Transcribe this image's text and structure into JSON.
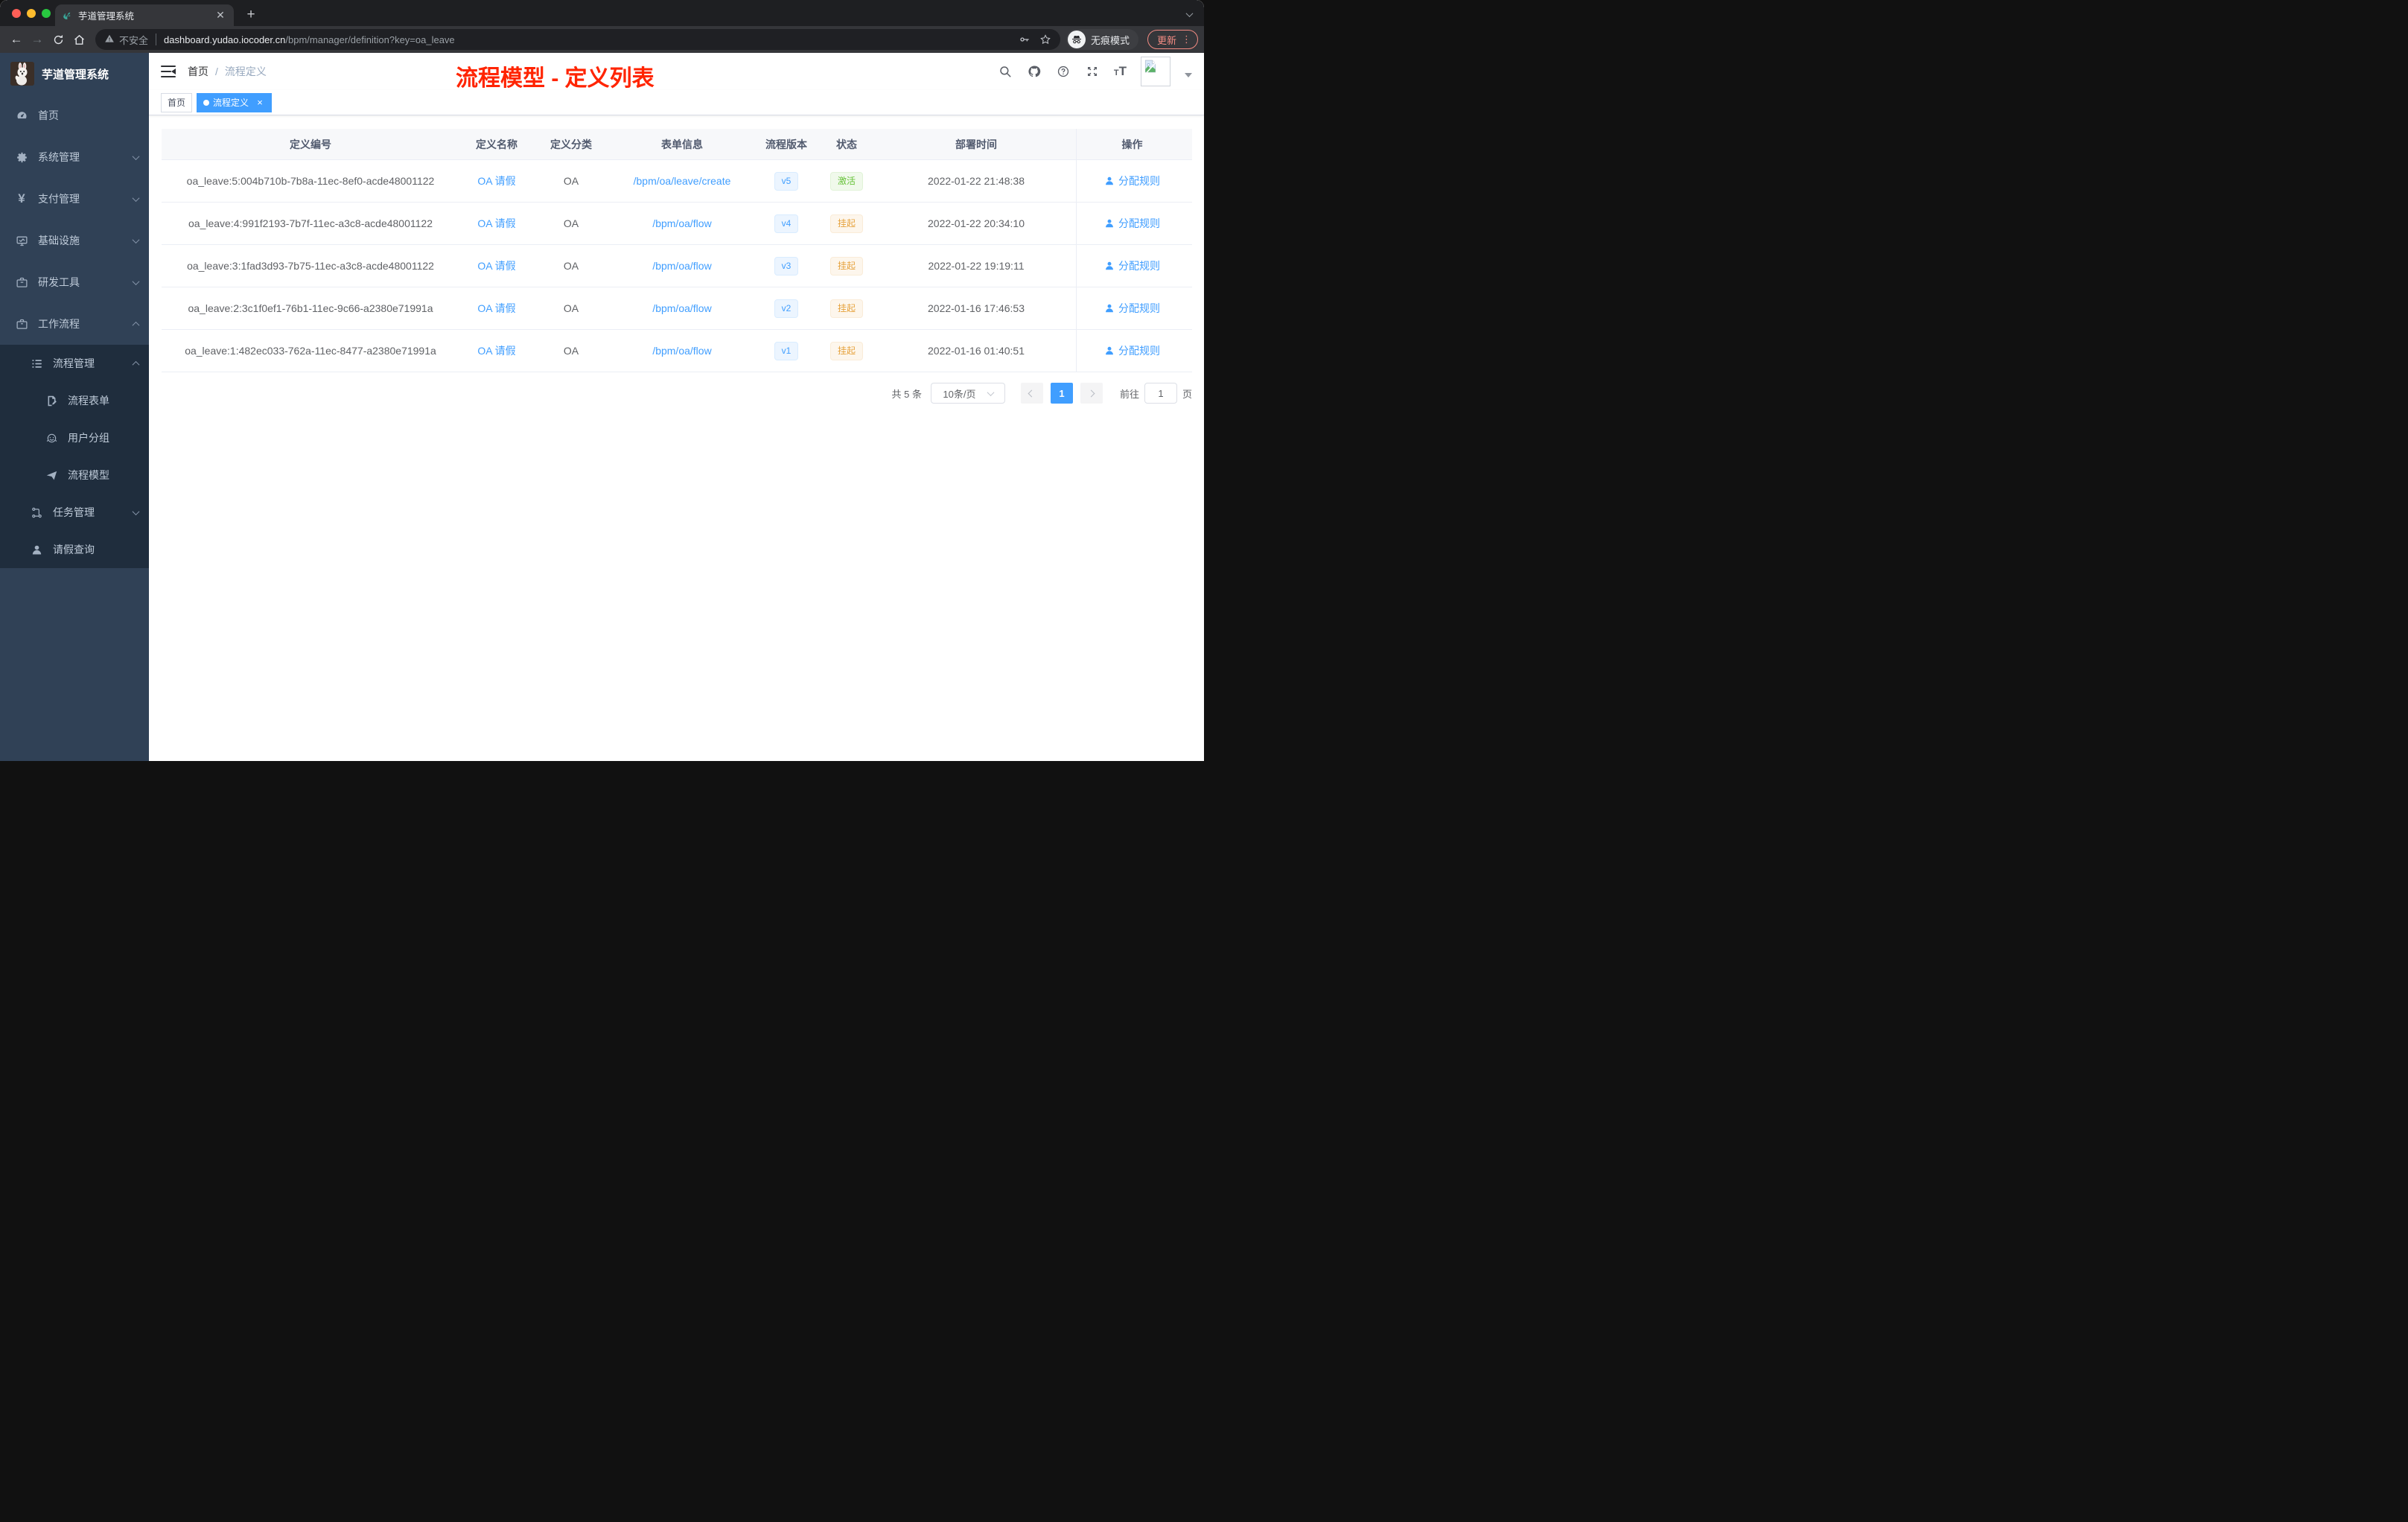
{
  "browser": {
    "tab_title": "芋道管理系统",
    "security_label": "不安全",
    "url_host": "dashboard.yudao.iocoder.cn",
    "url_path": "/bpm/manager/definition?key=oa_leave",
    "incognito_label": "无痕模式",
    "update_label": "更新"
  },
  "sidebar": {
    "logo_title": "芋道管理系统",
    "items": [
      {
        "key": "home",
        "label": "首页",
        "icon": "dashboard-icon",
        "level": 1,
        "chevron": "",
        "dark": false
      },
      {
        "key": "system",
        "label": "系统管理",
        "icon": "gear-icon",
        "level": 1,
        "chevron": "down",
        "dark": false
      },
      {
        "key": "pay",
        "label": "支付管理",
        "icon": "yen-icon",
        "level": 1,
        "chevron": "down",
        "dark": false
      },
      {
        "key": "infra",
        "label": "基础设施",
        "icon": "monitor-icon",
        "level": 1,
        "chevron": "down",
        "dark": false
      },
      {
        "key": "devtools",
        "label": "研发工具",
        "icon": "toolbox-icon",
        "level": 1,
        "chevron": "down",
        "dark": false
      },
      {
        "key": "workflow",
        "label": "工作流程",
        "icon": "briefcase-icon",
        "level": 1,
        "chevron": "up",
        "dark": false
      },
      {
        "key": "process-mgmt",
        "label": "流程管理",
        "icon": "list-icon",
        "level": 2,
        "chevron": "up",
        "dark": true
      },
      {
        "key": "process-form",
        "label": "流程表单",
        "icon": "form-icon",
        "level": 3,
        "chevron": "",
        "dark": true
      },
      {
        "key": "user-group",
        "label": "用户分组",
        "icon": "robot-icon",
        "level": 3,
        "chevron": "",
        "dark": true
      },
      {
        "key": "process-model",
        "label": "流程模型",
        "icon": "plane-icon",
        "level": 3,
        "chevron": "",
        "dark": true
      },
      {
        "key": "task-mgmt",
        "label": "任务管理",
        "icon": "tree-icon",
        "level": 2,
        "chevron": "down",
        "dark": true
      },
      {
        "key": "leave-query",
        "label": "请假查询",
        "icon": "user-icon",
        "level": 2,
        "chevron": "",
        "dark": true
      }
    ]
  },
  "header": {
    "breadcrumb": [
      "首页",
      "流程定义"
    ],
    "breadcrumb_separator": "/",
    "annotation": "流程模型 - 定义列表"
  },
  "tags": [
    {
      "label": "首页",
      "active": false
    },
    {
      "label": "流程定义",
      "active": true
    }
  ],
  "table": {
    "columns": [
      "定义编号",
      "定义名称",
      "定义分类",
      "表单信息",
      "流程版本",
      "状态",
      "部署时间",
      "操作"
    ],
    "rows": [
      {
        "id": "oa_leave:5:004b710b-7b8a-11ec-8ef0-acde48001122",
        "name": "OA 请假",
        "category": "OA",
        "form": "/bpm/oa/leave/create",
        "version": "v5",
        "status": "激活",
        "status_type": "success",
        "time": "2022-01-22 21:48:38",
        "action": "分配规则"
      },
      {
        "id": "oa_leave:4:991f2193-7b7f-11ec-a3c8-acde48001122",
        "name": "OA 请假",
        "category": "OA",
        "form": "/bpm/oa/flow",
        "version": "v4",
        "status": "挂起",
        "status_type": "warning",
        "time": "2022-01-22 20:34:10",
        "action": "分配规则"
      },
      {
        "id": "oa_leave:3:1fad3d93-7b75-11ec-a3c8-acde48001122",
        "name": "OA 请假",
        "category": "OA",
        "form": "/bpm/oa/flow",
        "version": "v3",
        "status": "挂起",
        "status_type": "warning",
        "time": "2022-01-22 19:19:11",
        "action": "分配规则"
      },
      {
        "id": "oa_leave:2:3c1f0ef1-76b1-11ec-9c66-a2380e71991a",
        "name": "OA 请假",
        "category": "OA",
        "form": "/bpm/oa/flow",
        "version": "v2",
        "status": "挂起",
        "status_type": "warning",
        "time": "2022-01-16 17:46:53",
        "action": "分配规则"
      },
      {
        "id": "oa_leave:1:482ec033-762a-11ec-8477-a2380e71991a",
        "name": "OA 请假",
        "category": "OA",
        "form": "/bpm/oa/flow",
        "version": "v1",
        "status": "挂起",
        "status_type": "warning",
        "time": "2022-01-16 01:40:51",
        "action": "分配规则"
      }
    ]
  },
  "pagination": {
    "total_label": "共 5 条",
    "page_size": "10条/页",
    "current_page": "1",
    "goto_label": "前往",
    "goto_value": "1",
    "page_suffix": "页"
  },
  "colors": {
    "accent": "#409eff",
    "success": "#67c23a",
    "warning": "#e6a23c",
    "annotation_red": "#ff2400",
    "sidebar_bg": "#304156",
    "submenu_bg": "#1f2d3d",
    "update_red": "#f28b82",
    "traffic_red": "#ff5f57",
    "traffic_yellow": "#febc2e",
    "traffic_green": "#28c840"
  }
}
